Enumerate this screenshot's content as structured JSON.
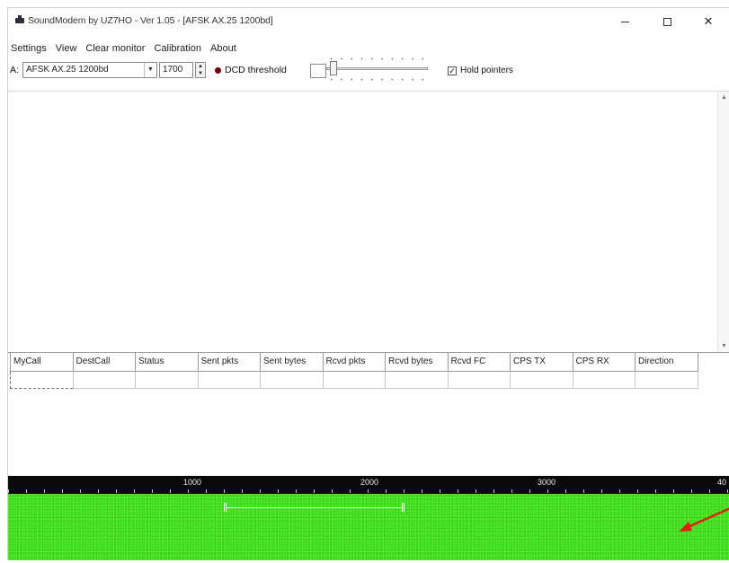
{
  "window": {
    "title": "SoundModem by UZ7HO - Ver 1.05 - [AFSK AX.25 1200bd]",
    "controls": {
      "minimize": "–",
      "maximize": "□",
      "close": "✕"
    }
  },
  "menu": [
    "Settings",
    "View",
    "Clear monitor",
    "Calibration",
    "About"
  ],
  "toolbar": {
    "channel_label": "A:",
    "mode_value": "AFSK AX.25 1200bd",
    "freq_value": "1700",
    "dcd_label": "DCD threshold",
    "hold_checked": true,
    "hold_label": "Hold pointers"
  },
  "connections": {
    "columns": [
      "MyCall",
      "DestCall",
      "Status",
      "Sent pkts",
      "Sent bytes",
      "Rcvd pkts",
      "Rcvd bytes",
      "Rcvd FC",
      "CPS TX",
      "CPS RX",
      "Direction"
    ],
    "rows": [
      [
        "",
        "",
        "",
        "",
        "",
        "",
        "",
        "",
        "",
        "",
        ""
      ]
    ]
  },
  "waterfall": {
    "scale_labels": [
      "1000",
      "2000",
      "3000",
      "40"
    ],
    "colors": {
      "background": "#39e01e",
      "ruler": "#0a0a0a",
      "annotation_arrow": "#e02010"
    }
  }
}
